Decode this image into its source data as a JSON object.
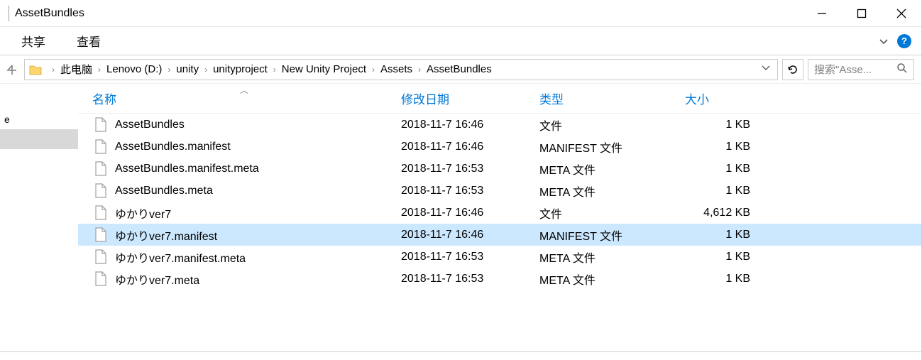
{
  "window": {
    "title": "AssetBundles"
  },
  "ribbon": {
    "tabs": [
      "共享",
      "查看"
    ]
  },
  "breadcrumbs": {
    "items": [
      "此电脑",
      "Lenovo (D:)",
      "unity",
      "unityproject",
      "New Unity Project",
      "Assets",
      "AssetBundles"
    ]
  },
  "search": {
    "placeholder": "搜索\"Asse..."
  },
  "nav_pane": {
    "items": [
      {
        "label": "",
        "selected": false
      },
      {
        "label": "e",
        "selected": false
      },
      {
        "label": "",
        "selected": true
      }
    ]
  },
  "columns": {
    "name": "名称",
    "date": "修改日期",
    "type": "类型",
    "size": "大小"
  },
  "files": [
    {
      "name": "AssetBundles",
      "date": "2018-11-7 16:46",
      "type": "文件",
      "size": "1 KB",
      "selected": false
    },
    {
      "name": "AssetBundles.manifest",
      "date": "2018-11-7 16:46",
      "type": "MANIFEST 文件",
      "size": "1 KB",
      "selected": false
    },
    {
      "name": "AssetBundles.manifest.meta",
      "date": "2018-11-7 16:53",
      "type": "META 文件",
      "size": "1 KB",
      "selected": false
    },
    {
      "name": "AssetBundles.meta",
      "date": "2018-11-7 16:53",
      "type": "META 文件",
      "size": "1 KB",
      "selected": false
    },
    {
      "name": "ゆかりver7",
      "date": "2018-11-7 16:46",
      "type": "文件",
      "size": "4,612 KB",
      "selected": false
    },
    {
      "name": "ゆかりver7.manifest",
      "date": "2018-11-7 16:46",
      "type": "MANIFEST 文件",
      "size": "1 KB",
      "selected": true
    },
    {
      "name": "ゆかりver7.manifest.meta",
      "date": "2018-11-7 16:53",
      "type": "META 文件",
      "size": "1 KB",
      "selected": false
    },
    {
      "name": "ゆかりver7.meta",
      "date": "2018-11-7 16:53",
      "type": "META 文件",
      "size": "1 KB",
      "selected": false
    }
  ]
}
